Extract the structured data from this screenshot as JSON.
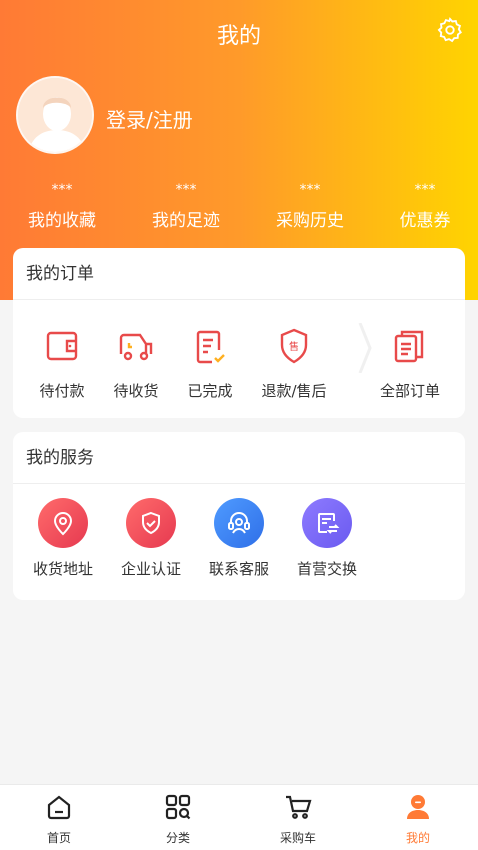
{
  "header": {
    "title": "我的",
    "login_text": "登录/注册"
  },
  "stats": [
    {
      "value": "***",
      "label": "我的收藏"
    },
    {
      "value": "***",
      "label": "我的足迹"
    },
    {
      "value": "***",
      "label": "采购历史"
    },
    {
      "value": "***",
      "label": "优惠券"
    }
  ],
  "orders": {
    "title": "我的订单",
    "items": [
      {
        "label": "待付款",
        "icon": "wallet-icon"
      },
      {
        "label": "待收货",
        "icon": "truck-icon"
      },
      {
        "label": "已完成",
        "icon": "check-doc-icon"
      },
      {
        "label": "退款/售后",
        "icon": "shield-sale-icon"
      },
      {
        "label": "全部订单",
        "icon": "orders-list-icon"
      }
    ]
  },
  "services": {
    "title": "我的服务",
    "items": [
      {
        "label": "收货地址",
        "icon": "location-icon"
      },
      {
        "label": "企业认证",
        "icon": "shield-check-icon"
      },
      {
        "label": "联系客服",
        "icon": "headset-icon"
      },
      {
        "label": "首营交换",
        "icon": "exchange-icon"
      }
    ]
  },
  "tabbar": [
    {
      "label": "首页",
      "icon": "home-icon"
    },
    {
      "label": "分类",
      "icon": "category-icon"
    },
    {
      "label": "采购车",
      "icon": "cart-icon"
    },
    {
      "label": "我的",
      "icon": "profile-icon"
    }
  ],
  "colors": {
    "gradient_start": "#ff7a35",
    "gradient_end": "#ffd400",
    "order_icon": "#e84a4a",
    "active_tab": "#ff7a35"
  }
}
